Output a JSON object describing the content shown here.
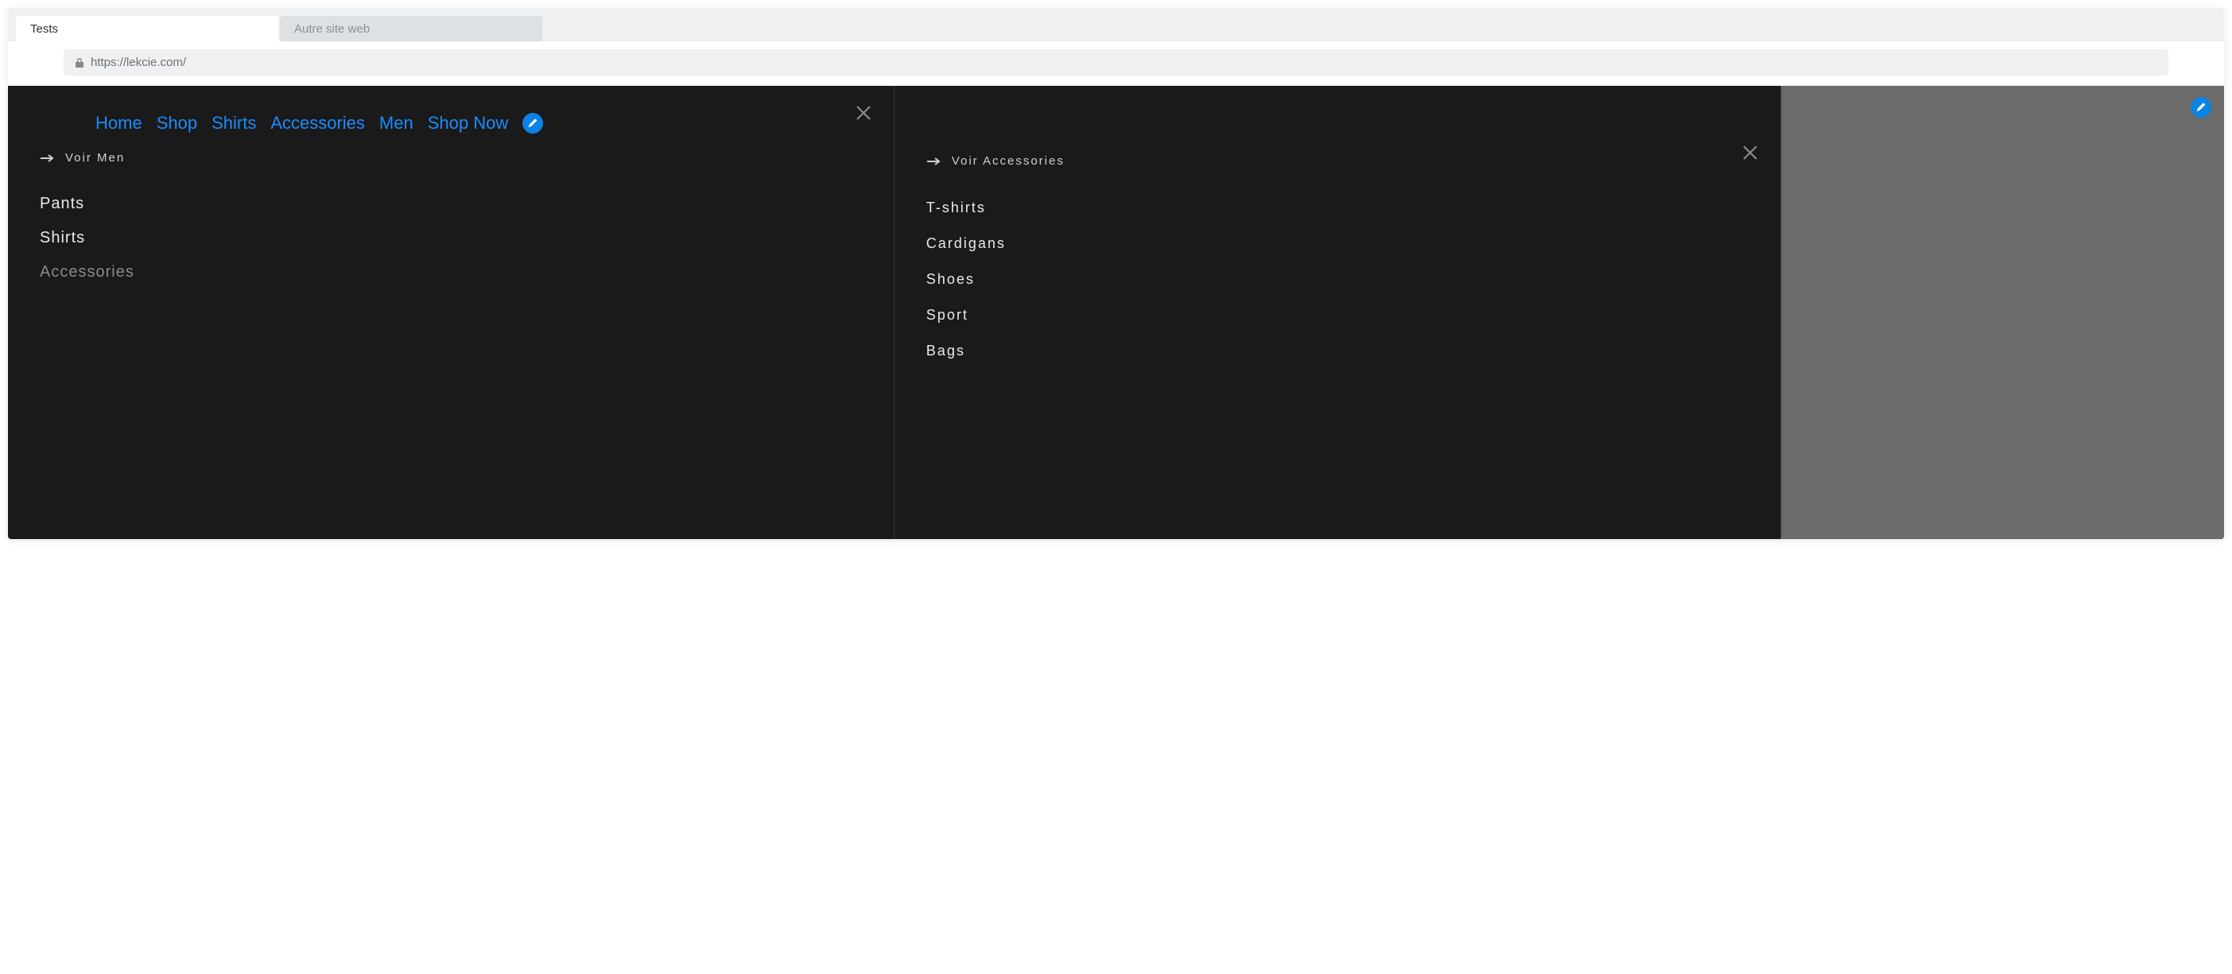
{
  "tabs": {
    "active": "Tests",
    "inactive": "Autre site web"
  },
  "address": {
    "url": "https://lekcie.com/"
  },
  "top_nav": [
    "Home",
    "Shop",
    "Shirts",
    "Accessories",
    "Men",
    "Shop Now"
  ],
  "panel_left": {
    "voir_label": "Voir Men",
    "items": [
      "Pants",
      "Shirts",
      "Accessories"
    ]
  },
  "panel_mid": {
    "voir_label": "Voir Accessories",
    "items": [
      "T-shirts",
      "Cardigans",
      "Shoes",
      "Sport",
      "Bags"
    ]
  }
}
